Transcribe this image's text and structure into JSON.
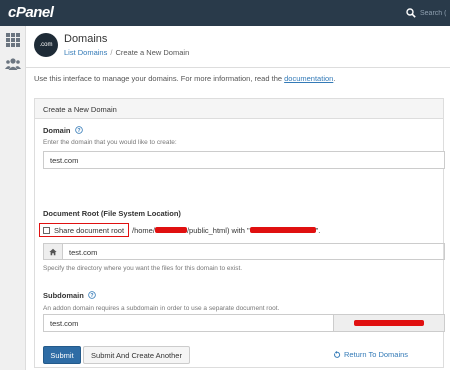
{
  "app": {
    "logo_text": "cPanel",
    "search_placeholder": "Search ("
  },
  "colors": {
    "topbar": "#293a4a",
    "primary": "#2e6ca5",
    "link": "#337ab7",
    "redaction": "#e01010"
  },
  "sidebar": {
    "items": [
      {
        "icon": "grid-icon"
      },
      {
        "icon": "users-icon"
      }
    ]
  },
  "header": {
    "logo_text": ".com",
    "title": "Domains",
    "breadcrumb": {
      "parent": "List Domains",
      "separator": "/",
      "current": "Create a New Domain"
    }
  },
  "intro": {
    "text": "Use this interface to manage your domains. For more information, read the ",
    "link": "documentation",
    "end": "."
  },
  "panel": {
    "heading": "Create a New Domain",
    "domain": {
      "label": "Domain",
      "hint": "Enter the domain that you would like to create:",
      "value": "test.com"
    },
    "docroot": {
      "label": "Document Root (File System Location)",
      "checkbox_label": "Share document root",
      "path_prefix": "/home/",
      "path_mid": "/public_html) with \"",
      "path_end": "\".",
      "value": "test.com",
      "hint": "Specify the directory where you want the files for this domain to exist."
    },
    "subdomain": {
      "label": "Subdomain",
      "hint": "An addon domain requires a subdomain in order to use a separate document root.",
      "value": "test.com"
    },
    "buttons": {
      "submit": "Submit",
      "submit_another": "Submit And Create Another",
      "return": "Return To Domains"
    }
  }
}
